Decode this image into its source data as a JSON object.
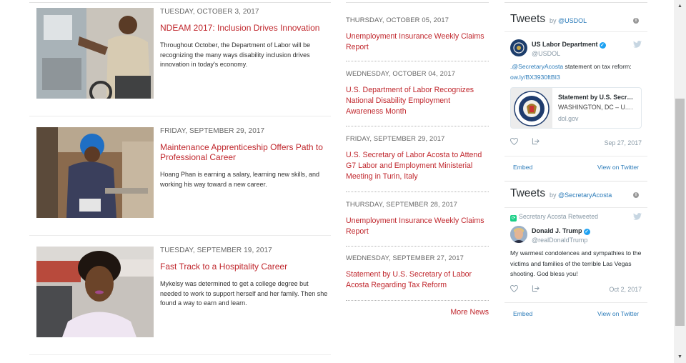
{
  "blog": {
    "items": [
      {
        "date": "TUESDAY, OCTOBER 3, 2017",
        "title": "NDEAM 2017: Inclusion Drives Innovation",
        "description": "Throughout October, the Department of Labor will be recognizing the many ways disability inclusion drives innovation in today's economy."
      },
      {
        "date": "FRIDAY, SEPTEMBER 29, 2017",
        "title": "Maintenance Apprenticeship Offers Path to Professional Career",
        "description": "Hoang Phan is earning a salary, learning new skills, and working his way toward a new career."
      },
      {
        "date": "TUESDAY, SEPTEMBER 19, 2017",
        "title": "Fast Track to a Hospitality Career",
        "description": "Mykelsy was determined to get a college degree but needed to work to support herself and her family. Then she found a way to earn and learn."
      }
    ]
  },
  "news": {
    "items": [
      {
        "date": "THURSDAY, OCTOBER 05, 2017",
        "title": "Unemployment Insurance Weekly Claims Report"
      },
      {
        "date": "WEDNESDAY, OCTOBER 04, 2017",
        "title": "U.S. Department of Labor Recognizes National Disability Employment Awareness Month"
      },
      {
        "date": "FRIDAY, SEPTEMBER 29, 2017",
        "title": "U.S. Secretary of Labor Acosta to Attend G7 Labor and Employment Ministerial Meeting in Turin, Italy"
      },
      {
        "date": "THURSDAY, SEPTEMBER 28, 2017",
        "title": "Unemployment Insurance Weekly Claims Report"
      },
      {
        "date": "WEDNESDAY, SEPTEMBER 27, 2017",
        "title": "Statement by U.S. Secretary of Labor Acosta Regarding Tax Reform"
      }
    ],
    "more_label": "More News"
  },
  "tweets": [
    {
      "label": "Tweets",
      "by": "by",
      "account": "@USDOL",
      "author_name": "US Labor Department",
      "author_handle": "@USDOL",
      "text_link": ".@SecretaryAcosta",
      "text": " statement on tax reform: ",
      "short_url": "ow.ly/BX3930ftBI3",
      "card": {
        "title": "Statement by U.S. Secr…",
        "subtitle": "WASHINGTON, DC – U.…",
        "url": "dol.gov"
      },
      "time": "Sep 27, 2017",
      "embed_label": "Embed",
      "view_label": "View on Twitter"
    },
    {
      "label": "Tweets",
      "by": "by",
      "account": "@SecretaryAcosta",
      "retweet_line": "Secretary Acosta Retweeted",
      "author_name": "Donald J. Trump",
      "author_handle": "@realDonaldTrump",
      "text": "My warmest condolences and sympathies to the victims and families of the terrible Las Vegas shooting. God bless you!",
      "time": "Oct 2, 2017",
      "embed_label": "Embed",
      "view_label": "View on Twitter"
    }
  ],
  "colors": {
    "link_red": "#c0272d",
    "twitter_blue": "#2b7bb9",
    "verified_blue": "#1da1f2",
    "retweet_green": "#19cf86"
  },
  "icons": {
    "info": "info-icon",
    "bird": "twitter-bird-icon",
    "heart": "heart-icon",
    "share": "share-icon",
    "verified": "verified-badge-icon",
    "retweet": "retweet-icon"
  }
}
